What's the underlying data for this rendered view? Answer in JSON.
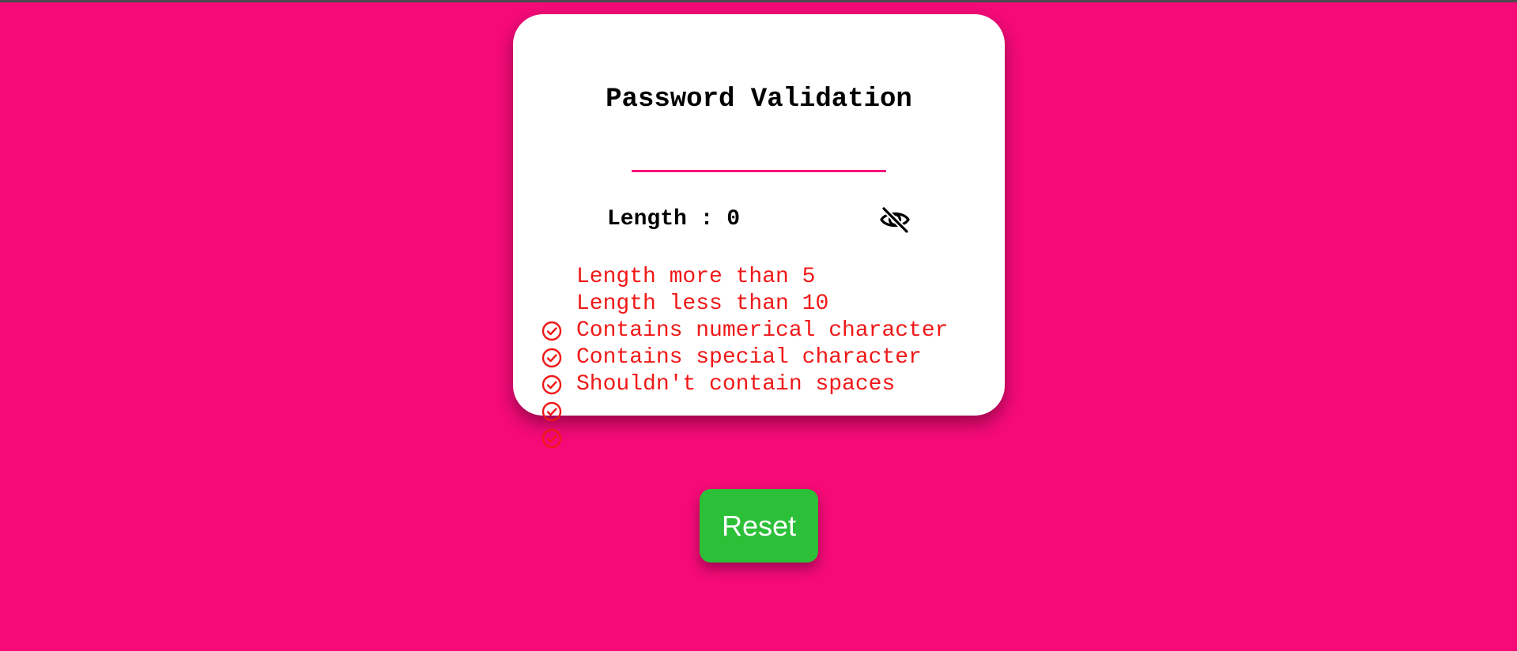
{
  "colors": {
    "background": "#f50a78",
    "card": "#ffffff",
    "accent": "#f50a78",
    "invalid_rule": "#f01818",
    "reset_button": "#2cbf38"
  },
  "card": {
    "title": "Password Validation",
    "password_input": {
      "value": "",
      "placeholder": "",
      "type": "password"
    },
    "length_label": "Length : 0",
    "visibility_toggle_icon": "eye-slash-icon"
  },
  "rules": [
    {
      "label": "Length more than 5",
      "icon": "check-circle-icon"
    },
    {
      "label": "Length less than 10",
      "icon": "check-circle-icon"
    },
    {
      "label": "Contains numerical character",
      "icon": "check-circle-icon"
    },
    {
      "label": "Contains special character",
      "icon": "check-circle-icon"
    },
    {
      "label": "Shouldn't contain spaces",
      "icon": "check-circle-icon"
    }
  ],
  "reset_button": {
    "label": "Reset"
  }
}
